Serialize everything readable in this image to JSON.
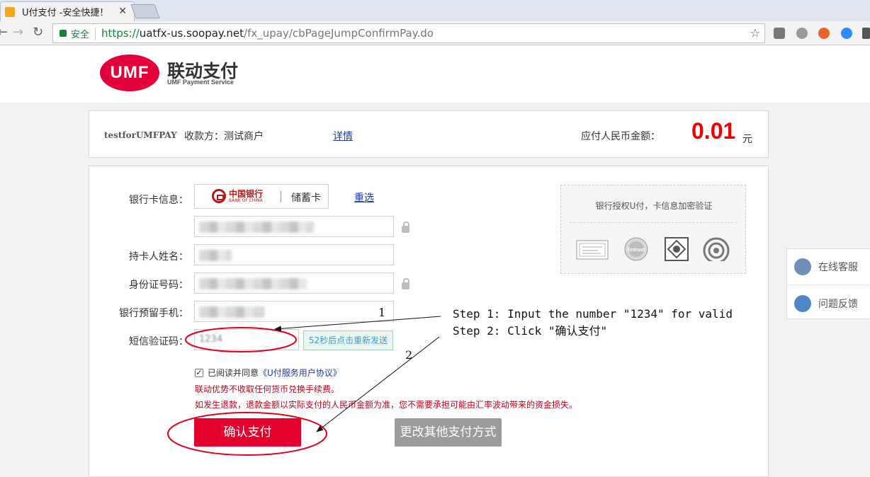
{
  "browser": {
    "tab_title": "U付支付 -安全快捷！",
    "close_glyph": "✕",
    "secure_label": "安全",
    "url_scheme": "https://",
    "url_host": "uatfx-us.soopay.net",
    "url_path": "/fx_upay/cbPageJumpConfirmPay.do",
    "back_glyph": "←",
    "forward_glyph": "→",
    "reload_glyph": "↻",
    "star_glyph": "☆"
  },
  "header": {
    "logo_mark": "UMF",
    "logo_cn": "联动支付",
    "logo_en": "UMF Payment Service"
  },
  "order": {
    "merchant_code": "testforUMFPAY",
    "payee": "收款方：测试商户",
    "detail_link": "详情",
    "amount_label": "应付人民币金额：",
    "amount": "0.01",
    "currency": "元"
  },
  "form": {
    "bank_label": "银行卡信息：",
    "bank_cn": "中国银行",
    "bank_en": "BANK OF CHINA",
    "card_type": "储蓄卡",
    "reselect_link": "重选",
    "holder_label": "持卡人姓名：",
    "id_label": "身份证号码：",
    "phone_label": "银行预留手机：",
    "sms_label": "短信验证码：",
    "sms_value": "1234",
    "sms_resend": "52秒后点击重新发送",
    "check_mark": "✓",
    "agree_text": "已阅读并同意",
    "agree_link": "《U付服务用户协议》",
    "notice_1": "联动优势不收取任何货币兑换手续费。",
    "notice_2": "如发生退款，退款金额以实际支付的人民币金额为准，您不需要承担可能由汇率波动带来的资金损失。",
    "pay_button": "确认支付",
    "alt_button": "更改其他支付方式"
  },
  "certificates": {
    "title": "银行授权U付，卡信息加密验证",
    "entrust": "Entrust"
  },
  "side": {
    "online_service": "在线客服",
    "feedback": "问题反馈"
  },
  "annotation": {
    "step1": "Step 1: Input the number \"1234\" for valid",
    "step2": "Step 2: Click \"确认支付\"",
    "num1": "1",
    "num2": "2"
  }
}
